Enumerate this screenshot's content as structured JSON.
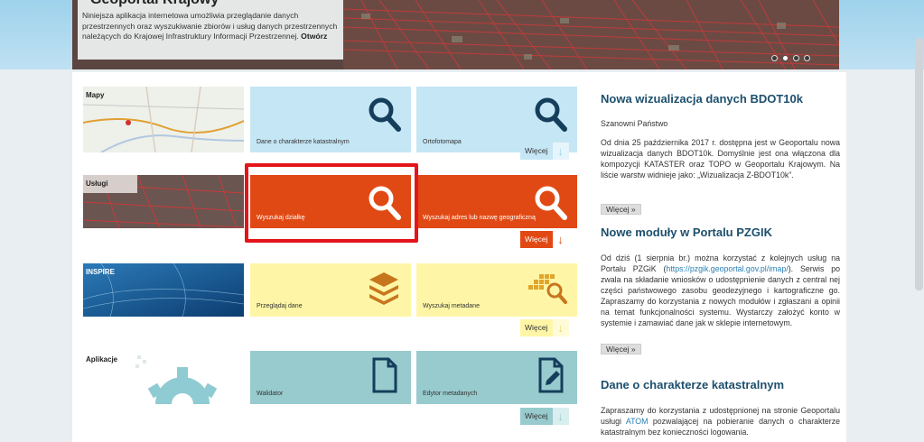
{
  "banner": {
    "title": "Geoportal Krajowy",
    "text": "Niniejsza aplikacja internetowa umożliwia przeglądanie danych przestrzennych oraz wyszukiwanie zbiorów i usług danych przestrzennych należących do Krajowej Infrastruktury Informacji Przestrzennej.",
    "open_link": "Otwórz",
    "active_dot": 2
  },
  "rows": [
    {
      "label": "Mapy",
      "tiles": [
        "Dane o charakterze katastralnym",
        "Ortofotomapa"
      ],
      "more": "Więcej"
    },
    {
      "label": "Usługi",
      "tiles": [
        "Wyszukaj działkę",
        "Wyszukaj adres lub nazwę geograficzną"
      ],
      "more": "Więcej"
    },
    {
      "label": "INSPIRE",
      "tiles": [
        "Przeglądaj dane",
        "Wyszukaj metadane"
      ],
      "more": "Więcej"
    },
    {
      "label": "Aplikacje",
      "tiles": [
        "Walidator",
        "Edytor metadanych"
      ],
      "more": "Więcej"
    }
  ],
  "icons": {
    "row1": [
      "search-icon",
      "search-icon"
    ],
    "row2": [
      "search-icon",
      "search-icon"
    ],
    "row3": [
      "layers-icon",
      "metadata-search-icon"
    ],
    "row4": [
      "document-icon",
      "edit-document-icon"
    ]
  },
  "colors": {
    "blue_tile": "#c5e6f5",
    "red_tile": "#e14914",
    "yellow_tile": "#fef6a6",
    "teal_tile": "#98cbce",
    "highlight": "#e4141b",
    "news_title": "#1d4f6d"
  },
  "news": [
    {
      "title": "Nowa wizualizacja danych BDOT10k",
      "greeting": "Szanowni Państwo",
      "body": "Od dnia 25 października 2017 r. dostępna jest w Geoportalu nowa wizualizacja danych BDOT10k. Domyślnie jest ona włączona dla kompozycji KATASTER oraz TOPO w Geoportalu Krajowym. Na liście warstw widnieje jako: „Wizualizacja Z-BDOT10k”.",
      "more": "Więcej »"
    },
    {
      "title": "Nowe moduły w Portalu PZGIK",
      "body_before": "Od dziś (1 sierpnia br.) można korzystać z kolejnych usług na Portalu PZGiK (",
      "link": "https://pzgik.geoportal.gov.pl/imap/",
      "body_after": "). Serwis po zwala na składanie wniosków o udostępnienie danych z central nej części państwowego zasobu geodezyjnego i kartograficzne go. Zapraszamy do korzystania z nowych modułów i zgłaszani a opinii na temat funkcjonalności systemu. Wystarczy założyć konto w systemie i zamawiać dane jak w sklepie internetowym.",
      "more": "Więcej »"
    },
    {
      "title": "Dane o charakterze katastralnym",
      "body_before": "Zapraszamy do korzystania z udostępnionej na stronie Geoportalu usługi ",
      "link": "ATOM",
      "body_after": " pozwalającej na pobieranie danych o charakterze katastralnym bez konieczności logowania."
    }
  ]
}
